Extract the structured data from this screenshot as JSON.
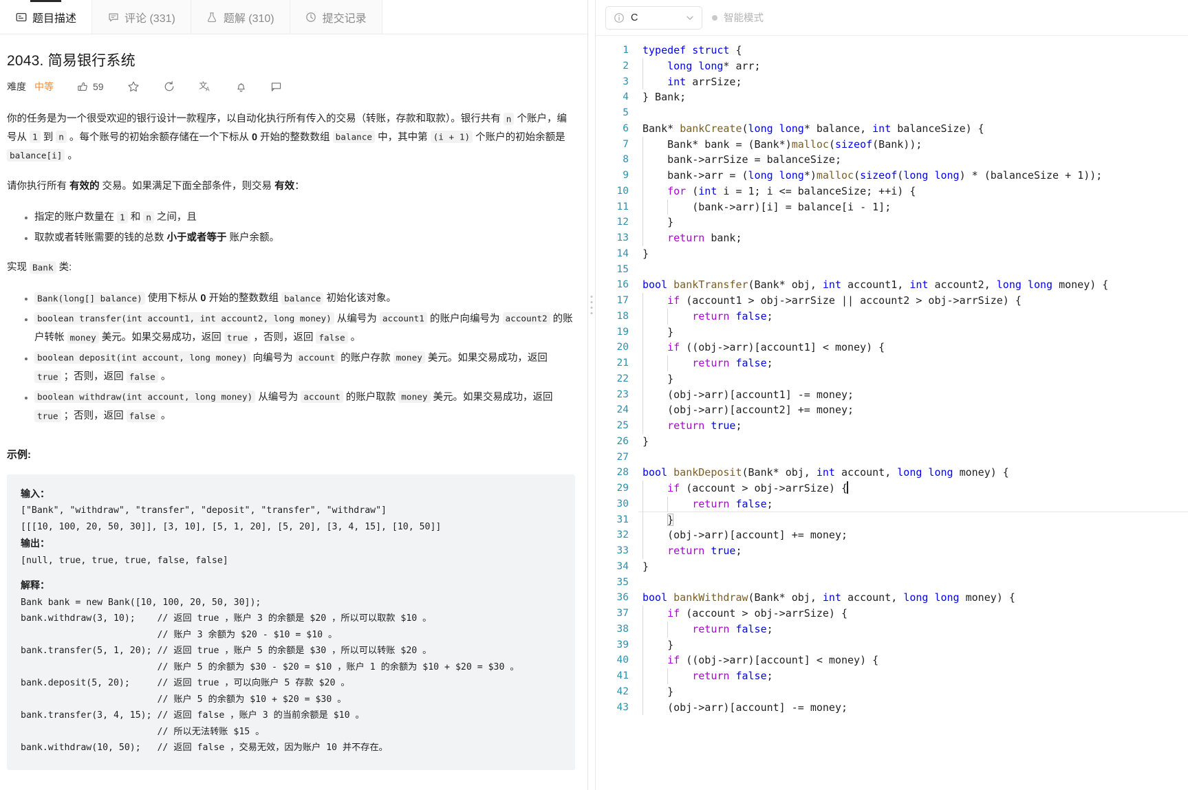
{
  "tabs": [
    {
      "label": "题目描述",
      "icon": "description-icon",
      "active": true
    },
    {
      "label": "评论 (331)",
      "icon": "comment-icon",
      "active": false
    },
    {
      "label": "题解 (310)",
      "icon": "flask-icon",
      "active": false
    },
    {
      "label": "提交记录",
      "icon": "clock-icon",
      "active": false
    }
  ],
  "problem": {
    "title": "2043. 简易银行系统",
    "difficulty_label": "难度",
    "difficulty": "中等",
    "likes": "59",
    "actions": [
      {
        "name": "like-button",
        "icon": "thumbs-up-icon"
      },
      {
        "name": "favorite-button",
        "icon": "star-icon"
      },
      {
        "name": "reset-button",
        "icon": "refresh-icon"
      },
      {
        "name": "translate-button",
        "icon": "translate-icon"
      },
      {
        "name": "notify-button",
        "icon": "bell-icon"
      },
      {
        "name": "feedback-button",
        "icon": "flag-icon"
      }
    ],
    "intro_1": "你的任务是为一个很受欢迎的银行设计一款程序，以自动化执行所有传入的交易（转账，存款和取款）。银行共有 ",
    "intro_code_n1": "n",
    "intro_2": " 个账户，编号从 ",
    "intro_code_1": "1",
    "intro_3": " 到 ",
    "intro_code_n2": "n",
    "intro_4": " 。每个账号的初始余额存储在一个下标从 ",
    "intro_bold_0": "0",
    "intro_5": " 开始的整数数组 ",
    "intro_code_balance": "balance",
    "intro_6": " 中，其中第 ",
    "intro_code_i1": "(i + 1)",
    "intro_7": " 个账户的初始余额是 ",
    "intro_code_bal_i": "balance[i]",
    "intro_8": " 。",
    "valid_1": "请你执行所有 ",
    "valid_bold_1": "有效的",
    "valid_2": " 交易。如果满足下面全部条件，则交易 ",
    "valid_bold_2": "有效",
    "valid_3": "：",
    "conditions": [
      {
        "p1": "指定的账户数量在 ",
        "c1": "1",
        "p2": " 和 ",
        "c2": "n",
        "p3": " 之间，且"
      },
      {
        "p1": "取款或者转账需要的钱的总数 ",
        "b1": "小于或者等于",
        "p2": " 账户余额。"
      }
    ],
    "impl_1": "实现 ",
    "impl_code": "Bank",
    "impl_2": " 类:",
    "methods": [
      {
        "sig": "Bank(long[] balance)",
        "t1": " 使用下标从 ",
        "b1": "0",
        "t2": " 开始的整数数组 ",
        "c1": "balance",
        "t3": " 初始化该对象。"
      },
      {
        "sig": "boolean transfer(int account1, int account2, long money)",
        "t1": " 从编号为 ",
        "c1": "account1",
        "t2": " 的账户向编号为 ",
        "c2": "account2",
        "t3": " 的账户转帐 ",
        "c3": "money",
        "t4": " 美元。如果交易成功，返回 ",
        "c4": "true",
        "t5": " ，否则，返回 ",
        "c5": "false",
        "t6": " 。"
      },
      {
        "sig": "boolean deposit(int account, long money)",
        "t1": " 向编号为 ",
        "c1": "account",
        "t2": " 的账户存款 ",
        "c2": "money",
        "t3": " 美元。如果交易成功，返回 ",
        "c3": "true",
        "t4": " ；否则，返回 ",
        "c4": "false",
        "t5": " 。"
      },
      {
        "sig": "boolean withdraw(int account, long money)",
        "t1": " 从编号为 ",
        "c1": "account",
        "t2": " 的账户取款 ",
        "c2": "money",
        "t3": " 美元。如果交易成功，返回 ",
        "c3": "true",
        "t4": " ；否则，返回 ",
        "c4": "false",
        "t5": " 。"
      }
    ],
    "example_heading": "示例:",
    "example": {
      "input_label": "输入：",
      "input_lines": [
        "[\"Bank\", \"withdraw\", \"transfer\", \"deposit\", \"transfer\", \"withdraw\"]",
        "[[[10, 100, 20, 50, 30]], [3, 10], [5, 1, 20], [5, 20], [3, 4, 15], [10, 50]]"
      ],
      "output_label": "输出：",
      "output_lines": [
        "[null, true, true, true, false, false]"
      ],
      "explain_label": "解释：",
      "explain_lines": [
        "Bank bank = new Bank([10, 100, 20, 50, 30]);",
        "bank.withdraw(3, 10);    // 返回 true ，账户 3 的余额是 $20 ，所以可以取款 $10 。",
        "                         // 账户 3 余额为 $20 - $10 = $10 。",
        "bank.transfer(5, 1, 20); // 返回 true ，账户 5 的余额是 $30 ，所以可以转账 $20 。",
        "                         // 账户 5 的余额为 $30 - $20 = $10 ，账户 1 的余额为 $10 + $20 = $30 。",
        "bank.deposit(5, 20);     // 返回 true ，可以向账户 5 存款 $20 。",
        "                         // 账户 5 的余额为 $10 + $20 = $30 。",
        "bank.transfer(3, 4, 15); // 返回 false ，账户 3 的当前余额是 $10 。",
        "                         // 所以无法转账 $15 。",
        "bank.withdraw(10, 50);   // 返回 false ，交易无效，因为账户 10 并不存在。"
      ]
    }
  },
  "editor": {
    "language": "C",
    "language_icon": "info-icon",
    "chevron_icon": "chevron-down-icon",
    "smart_mode_label": "智能模式",
    "smart_mode_dot": "status-dot",
    "first_line_number": 1,
    "code_lines": [
      {
        "n": 1,
        "indent": 0,
        "tokens": [
          [
            "kw",
            "typedef"
          ],
          [
            "pl",
            " "
          ],
          [
            "kw",
            "struct"
          ],
          [
            "pl",
            " {"
          ]
        ]
      },
      {
        "n": 2,
        "indent": 1,
        "tokens": [
          [
            "kw",
            "long long"
          ],
          [
            "pl",
            "* arr;"
          ]
        ]
      },
      {
        "n": 3,
        "indent": 1,
        "tokens": [
          [
            "kw",
            "int"
          ],
          [
            "pl",
            " arrSize;"
          ]
        ]
      },
      {
        "n": 4,
        "indent": 0,
        "tokens": [
          [
            "pl",
            "} Bank;"
          ]
        ]
      },
      {
        "n": 5,
        "indent": 0,
        "tokens": []
      },
      {
        "n": 6,
        "indent": 0,
        "tokens": [
          [
            "pl",
            "Bank* "
          ],
          [
            "fn",
            "bankCreate"
          ],
          [
            "pl",
            "("
          ],
          [
            "kw",
            "long long"
          ],
          [
            "pl",
            "* balance, "
          ],
          [
            "kw",
            "int"
          ],
          [
            "pl",
            " balanceSize) {"
          ]
        ]
      },
      {
        "n": 7,
        "indent": 1,
        "tokens": [
          [
            "pl",
            "Bank* bank = (Bank*)"
          ],
          [
            "fn",
            "malloc"
          ],
          [
            "pl",
            "("
          ],
          [
            "kw",
            "sizeof"
          ],
          [
            "pl",
            "(Bank));"
          ]
        ]
      },
      {
        "n": 8,
        "indent": 1,
        "tokens": [
          [
            "pl",
            "bank->arrSize = balanceSize;"
          ]
        ]
      },
      {
        "n": 9,
        "indent": 1,
        "tokens": [
          [
            "pl",
            "bank->arr = ("
          ],
          [
            "kw",
            "long long"
          ],
          [
            "pl",
            "*)"
          ],
          [
            "fn",
            "malloc"
          ],
          [
            "pl",
            "("
          ],
          [
            "kw",
            "sizeof"
          ],
          [
            "pl",
            "("
          ],
          [
            "kw",
            "long long"
          ],
          [
            "pl",
            ") * (balanceSize + "
          ],
          [
            "pl",
            "1));"
          ]
        ]
      },
      {
        "n": 10,
        "indent": 1,
        "tokens": [
          [
            "ctl",
            "for"
          ],
          [
            "pl",
            " ("
          ],
          [
            "kw",
            "int"
          ],
          [
            "pl",
            " i = 1; i <= balanceSize; ++i) {"
          ]
        ]
      },
      {
        "n": 11,
        "indent": 2,
        "tokens": [
          [
            "pl",
            "(bank->arr)[i] = balance[i - 1];"
          ]
        ]
      },
      {
        "n": 12,
        "indent": 1,
        "tokens": [
          [
            "pl",
            "}"
          ]
        ]
      },
      {
        "n": 13,
        "indent": 1,
        "tokens": [
          [
            "ctl",
            "return"
          ],
          [
            "pl",
            " bank;"
          ]
        ]
      },
      {
        "n": 14,
        "indent": 0,
        "tokens": [
          [
            "pl",
            "}"
          ]
        ]
      },
      {
        "n": 15,
        "indent": 0,
        "tokens": []
      },
      {
        "n": 16,
        "indent": 0,
        "tokens": [
          [
            "kw",
            "bool"
          ],
          [
            "pl",
            " "
          ],
          [
            "fn",
            "bankTransfer"
          ],
          [
            "pl",
            "(Bank* obj, "
          ],
          [
            "kw",
            "int"
          ],
          [
            "pl",
            " account1, "
          ],
          [
            "kw",
            "int"
          ],
          [
            "pl",
            " account2, "
          ],
          [
            "kw",
            "long long"
          ],
          [
            "pl",
            " money) {"
          ]
        ]
      },
      {
        "n": 17,
        "indent": 1,
        "tokens": [
          [
            "ctl",
            "if"
          ],
          [
            "pl",
            " (account1 > obj->arrSize || account2 > obj->arrSize) {"
          ]
        ]
      },
      {
        "n": 18,
        "indent": 2,
        "tokens": [
          [
            "ctl",
            "return"
          ],
          [
            "pl",
            " "
          ],
          [
            "lit",
            "false"
          ],
          [
            "pl",
            ";"
          ]
        ]
      },
      {
        "n": 19,
        "indent": 1,
        "tokens": [
          [
            "pl",
            "}"
          ]
        ]
      },
      {
        "n": 20,
        "indent": 1,
        "tokens": [
          [
            "ctl",
            "if"
          ],
          [
            "pl",
            " ((obj->arr)[account1] < money) {"
          ]
        ]
      },
      {
        "n": 21,
        "indent": 2,
        "tokens": [
          [
            "ctl",
            "return"
          ],
          [
            "pl",
            " "
          ],
          [
            "lit",
            "false"
          ],
          [
            "pl",
            ";"
          ]
        ]
      },
      {
        "n": 22,
        "indent": 1,
        "tokens": [
          [
            "pl",
            "}"
          ]
        ]
      },
      {
        "n": 23,
        "indent": 1,
        "tokens": [
          [
            "pl",
            "(obj->arr)[account1] -= money;"
          ]
        ]
      },
      {
        "n": 24,
        "indent": 1,
        "tokens": [
          [
            "pl",
            "(obj->arr)[account2] += money;"
          ]
        ]
      },
      {
        "n": 25,
        "indent": 1,
        "tokens": [
          [
            "ctl",
            "return"
          ],
          [
            "pl",
            " "
          ],
          [
            "lit",
            "true"
          ],
          [
            "pl",
            ";"
          ]
        ]
      },
      {
        "n": 26,
        "indent": 0,
        "tokens": [
          [
            "pl",
            "}"
          ]
        ]
      },
      {
        "n": 27,
        "indent": 0,
        "tokens": []
      },
      {
        "n": 28,
        "indent": 0,
        "tokens": [
          [
            "kw",
            "bool"
          ],
          [
            "pl",
            " "
          ],
          [
            "fn",
            "bankDeposit"
          ],
          [
            "pl",
            "(Bank* obj, "
          ],
          [
            "kw",
            "int"
          ],
          [
            "pl",
            " account, "
          ],
          [
            "kw",
            "long long"
          ],
          [
            "pl",
            " money) {"
          ]
        ]
      },
      {
        "n": 29,
        "indent": 1,
        "tokens": [
          [
            "ctl",
            "if"
          ],
          [
            "pl",
            " (account > obj->arrSize) {"
          ]
        ],
        "caret_end": true
      },
      {
        "n": 30,
        "indent": 2,
        "tokens": [
          [
            "ctl",
            "return"
          ],
          [
            "pl",
            " "
          ],
          [
            "lit",
            "false"
          ],
          [
            "pl",
            ";"
          ]
        ],
        "highlight": true
      },
      {
        "n": 31,
        "indent": 1,
        "tokens": [
          [
            "pl",
            "}"
          ]
        ],
        "brace_match": true
      },
      {
        "n": 32,
        "indent": 1,
        "tokens": [
          [
            "pl",
            "(obj->arr)[account] += money;"
          ]
        ]
      },
      {
        "n": 33,
        "indent": 1,
        "tokens": [
          [
            "ctl",
            "return"
          ],
          [
            "pl",
            " "
          ],
          [
            "lit",
            "true"
          ],
          [
            "pl",
            ";"
          ]
        ]
      },
      {
        "n": 34,
        "indent": 0,
        "tokens": [
          [
            "pl",
            "}"
          ]
        ]
      },
      {
        "n": 35,
        "indent": 0,
        "tokens": []
      },
      {
        "n": 36,
        "indent": 0,
        "tokens": [
          [
            "kw",
            "bool"
          ],
          [
            "pl",
            " "
          ],
          [
            "fn",
            "bankWithdraw"
          ],
          [
            "pl",
            "(Bank* obj, "
          ],
          [
            "kw",
            "int"
          ],
          [
            "pl",
            " account, "
          ],
          [
            "kw",
            "long long"
          ],
          [
            "pl",
            " money) {"
          ]
        ]
      },
      {
        "n": 37,
        "indent": 1,
        "tokens": [
          [
            "ctl",
            "if"
          ],
          [
            "pl",
            " (account > obj->arrSize) {"
          ]
        ]
      },
      {
        "n": 38,
        "indent": 2,
        "tokens": [
          [
            "ctl",
            "return"
          ],
          [
            "pl",
            " "
          ],
          [
            "lit",
            "false"
          ],
          [
            "pl",
            ";"
          ]
        ]
      },
      {
        "n": 39,
        "indent": 1,
        "tokens": [
          [
            "pl",
            "}"
          ]
        ]
      },
      {
        "n": 40,
        "indent": 1,
        "tokens": [
          [
            "ctl",
            "if"
          ],
          [
            "pl",
            " ((obj->arr)[account] < money) {"
          ]
        ]
      },
      {
        "n": 41,
        "indent": 2,
        "tokens": [
          [
            "ctl",
            "return"
          ],
          [
            "pl",
            " "
          ],
          [
            "lit",
            "false"
          ],
          [
            "pl",
            ";"
          ]
        ]
      },
      {
        "n": 42,
        "indent": 1,
        "tokens": [
          [
            "pl",
            "}"
          ]
        ]
      },
      {
        "n": 43,
        "indent": 1,
        "tokens": [
          [
            "pl",
            "(obj->arr)[account] -= money;"
          ]
        ]
      }
    ]
  },
  "colors": {
    "accent_difficulty": "#ef8b30",
    "keyword": "#0000ff",
    "control": "#af00db",
    "function": "#795e26",
    "line_number": "#2b91af",
    "code_bg": "#ffffff",
    "example_bg": "#f2f3f4"
  }
}
